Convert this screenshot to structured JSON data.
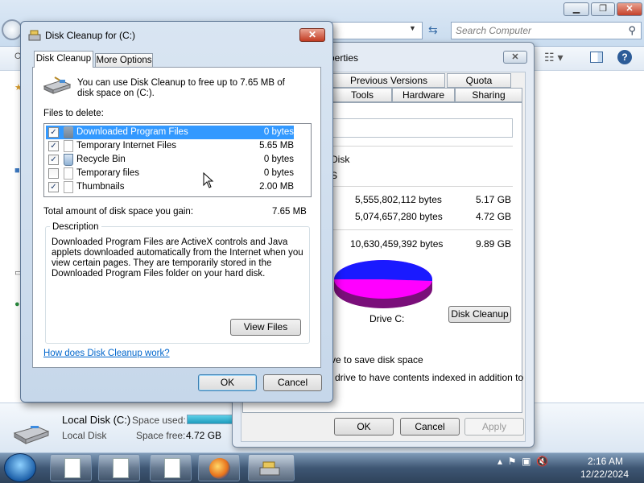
{
  "explorer": {
    "search_placeholder": "Search Computer",
    "details": {
      "drive_name": "Local Disk (C:)",
      "drive_type": "Local Disk",
      "space_used_label": "Space used:",
      "space_used_fraction": 0.48,
      "space_free_label": "Space free:",
      "space_free_value": "4.72 GB"
    }
  },
  "properties": {
    "title_fragment": "perties",
    "tabs_row1": [
      "Previous Versions",
      "Quota"
    ],
    "tabs_row2": [
      "Tools",
      "Hardware",
      "Sharing"
    ],
    "type_fragment": "l Disk",
    "fs_fragment": "S",
    "used_bytes": "5,555,802,112 bytes",
    "used_gb": "5.17 GB",
    "free_bytes": "5,074,657,280 bytes",
    "free_gb": "4.72 GB",
    "capacity_bytes": "10,630,459,392 bytes",
    "capacity_gb": "9.89 GB",
    "drive_label": "Drive C:",
    "disk_cleanup_button": "Disk Cleanup",
    "compress_fragment": "ve to save disk space",
    "index_fragment": "drive to have contents indexed in addition to",
    "ok": "OK",
    "cancel": "Cancel",
    "apply": "Apply",
    "colors": {
      "used": "#1a1aff",
      "free": "#ff00ff"
    }
  },
  "cleanup": {
    "title": "Disk Cleanup for  (C:)",
    "tabs": [
      "Disk Cleanup",
      "More Options"
    ],
    "intro": "You can use Disk Cleanup to free up to 7.65 MB of disk space on  (C:).",
    "files_label": "Files to delete:",
    "files": [
      {
        "name": "Downloaded Program Files",
        "size": "0 bytes",
        "checked": true,
        "selected": true
      },
      {
        "name": "Temporary Internet Files",
        "size": "5.65 MB",
        "checked": true,
        "selected": false
      },
      {
        "name": "Recycle Bin",
        "size": "0 bytes",
        "checked": true,
        "selected": false
      },
      {
        "name": "Temporary files",
        "size": "0 bytes",
        "checked": false,
        "selected": false
      },
      {
        "name": "Thumbnails",
        "size": "2.00 MB",
        "checked": true,
        "selected": false
      }
    ],
    "total_label": "Total amount of disk space you gain:",
    "total_value": "7.65 MB",
    "description_title": "Description",
    "description": "Downloaded Program Files are ActiveX controls and Java applets downloaded automatically from the Internet when you view certain pages. They are temporarily stored in the Downloaded Program Files folder on your hard disk.",
    "view_files": "View Files",
    "help_link": "How does Disk Cleanup work?",
    "ok": "OK",
    "cancel": "Cancel"
  },
  "taskbar": {
    "time": "2:16 AM",
    "date": "12/22/2024"
  }
}
